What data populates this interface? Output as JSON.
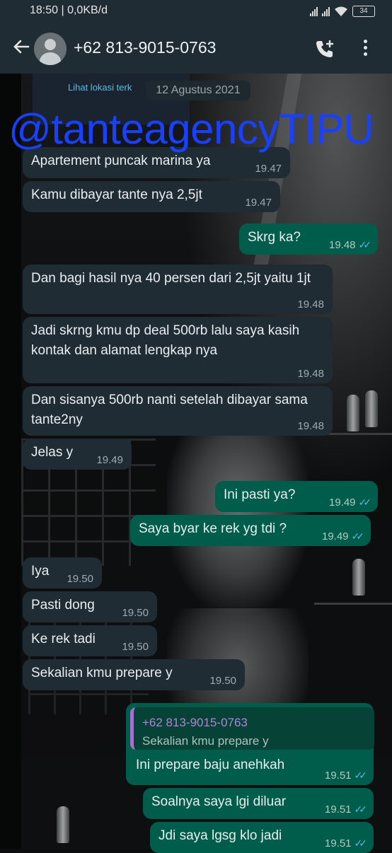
{
  "status": {
    "time": "18:50 | 0,0KB/d",
    "battery": "34"
  },
  "header": {
    "title": "+62 813-9015-0763"
  },
  "map": {
    "link": "Lihat lokasi terk"
  },
  "date_chip": "12 Agustus 2021",
  "watermark": "@tanteagencyTIPU",
  "messages": [
    {
      "dir": "in",
      "text": "Apartement puncak marina ya",
      "time": "19.47"
    },
    {
      "dir": "in",
      "text": "Kamu dibayar tante nya 2,5jt",
      "time": "19.47"
    },
    {
      "dir": "out",
      "text": "Skrg ka?",
      "time": "19.48"
    },
    {
      "dir": "in",
      "text": "Dan bagi hasil nya 40 persen dari 2,5jt yaitu 1jt",
      "time": "19.48"
    },
    {
      "dir": "in",
      "text": "Jadi skrng kmu dp deal 500rb lalu saya kasih kontak dan alamat lengkap nya",
      "time": "19.48"
    },
    {
      "dir": "in",
      "text": "Dan sisanya 500rb nanti setelah dibayar sama tante2ny",
      "time": "19.48"
    },
    {
      "dir": "in",
      "text": "Jelas y",
      "time": "19.49"
    },
    {
      "dir": "out",
      "text": "Ini pasti ya?",
      "time": "19.49"
    },
    {
      "dir": "out",
      "text": "Saya byar ke rek yg tdi ?",
      "time": "19.49"
    },
    {
      "dir": "in",
      "text": "Iya",
      "time": "19.50"
    },
    {
      "dir": "in",
      "text": "Pasti dong",
      "time": "19.50"
    },
    {
      "dir": "in",
      "text": "Ke rek tadi",
      "time": "19.50"
    },
    {
      "dir": "in",
      "text": "Sekalian kmu prepare y",
      "time": "19.50"
    },
    {
      "dir": "out",
      "text": "Ini prepare baju anehkah",
      "time": "19.51",
      "quote": {
        "name": "+62 813-9015-0763",
        "text": "Sekalian kmu prepare y"
      }
    },
    {
      "dir": "out",
      "text": "Soalnya saya lgi diluar",
      "time": "19.51"
    },
    {
      "dir": "out",
      "text": "Jdi saya lgsg klo jadi",
      "time": "19.51"
    }
  ],
  "colors": {
    "incoming": "#1f2c34",
    "outgoing": "#005c4b",
    "read_tick": "#53bdeb",
    "watermark": "#1a40ff"
  }
}
